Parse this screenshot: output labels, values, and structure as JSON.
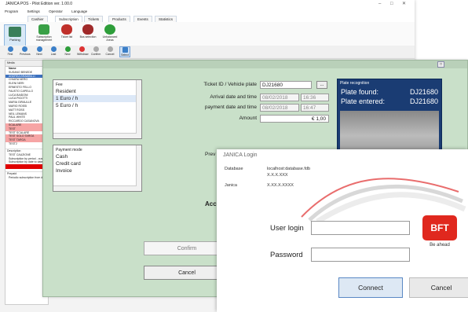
{
  "back": {
    "title": "JANICA POS - Pilot Edition ver. 1.00.0",
    "window_controls": [
      "–",
      "□",
      "✕"
    ],
    "menu": [
      "Program",
      "Settings",
      "Operator",
      "Language"
    ],
    "ribbon_tabs": [
      "Cashier",
      "Subscription",
      "Tickets",
      "Products",
      "Events",
      "Statistics"
    ],
    "ribbon_buttons": [
      {
        "label": "Parking",
        "icon": "parking-icon"
      },
      {
        "label": "Subscription management",
        "icon": "subscription-add-icon"
      },
      {
        "label": "Ticket list",
        "icon": "car-icon"
      },
      {
        "label": "Bus selection",
        "icon": "car-icon"
      },
      {
        "label": "Unbalanced Areas",
        "icon": "recycle-icon"
      }
    ],
    "toolbar": [
      "First",
      "Previous",
      "Next",
      "Last",
      "New",
      "Withdraw",
      "Confirm",
      "Cancel",
      "Select"
    ],
    "list_panel_header": "Media",
    "list_column": "Name",
    "list_items": [
      "SUSANO BENEDE",
      "ANDREA BRAMBILLI",
      "CHIARA NERO",
      "ELENI NERI",
      "ERNESTO FELLO",
      "FAUSTO CAPELLO",
      "LUCA BAIDONI",
      "LUCA PIGOTTI",
      "MARIA GIRAULLE",
      "MARIO ROSSI",
      "MATT ROSS",
      "NEIL LEMANS",
      "PAUL WHITE",
      "RICCARDO CASANOVA",
      "SCALARE",
      "TEST",
      "TEST SCALARE",
      "TEST SOLO TARGA",
      "TEST TARGA",
      "TEST2"
    ],
    "description_label": "Description",
    "description_items": [
      "TEST CAUZIONE",
      "Subscription by period - cust",
      "Subscription by date to date"
    ],
    "prepaid_label": "Prepaid",
    "prepaid_text": "Periodic subscription from dr"
  },
  "mid": {
    "fee": {
      "label": "Fee",
      "items": [
        "Resident",
        "1 Euro / h",
        "5 Euro / h"
      ]
    },
    "payment_mode": {
      "label": "Payment mode",
      "items": [
        "Cash",
        "Credit card",
        "Invoice"
      ]
    },
    "ticket_label": "Ticket ID / Vehicle plate",
    "ticket_value": "DJ21680",
    "dots_label": "...",
    "arrival_label": "Arrival date and time",
    "arrival_date": "08/02/2018",
    "arrival_time": "16:36",
    "payment_label": "payment date and time",
    "payment_date": "08/02/2018",
    "payment_time": "16:47",
    "amount_label": "Amount",
    "amount_value": "€ 1,00",
    "plate_recognition": {
      "title": "Plate recognition",
      "found_label": "Plate found:",
      "found_value": "DJ21680",
      "entered_label": "Plate entered:",
      "entered_value": "DJ21680"
    },
    "partial_prev": "Prev",
    "partial_acc": "Acc",
    "confirm_label": "Confirm",
    "cancel_label": "Cancel"
  },
  "login": {
    "title": "JANICA Login",
    "database_label": "Database",
    "database_value": "localhost:database.fdb",
    "database_version": "X.X.X.XXX",
    "janica_label": "Janica",
    "janica_value": "X.XX.X.XXXX",
    "user_label": "User login",
    "user_value": "",
    "password_label": "Password",
    "password_value": "",
    "connect_label": "Connect",
    "cancel_label": "Cancel",
    "logo_text": "BFT",
    "logo_tagline": "Be ahead"
  },
  "colors": {
    "form_bg": "#c9e0c9",
    "plate_panel": "#1a3c73",
    "brand_red": "#e0281e",
    "selected_row": "#3d72c0",
    "highlight_row": "#f6a5a5",
    "connect_btn": "#dde8f4"
  }
}
